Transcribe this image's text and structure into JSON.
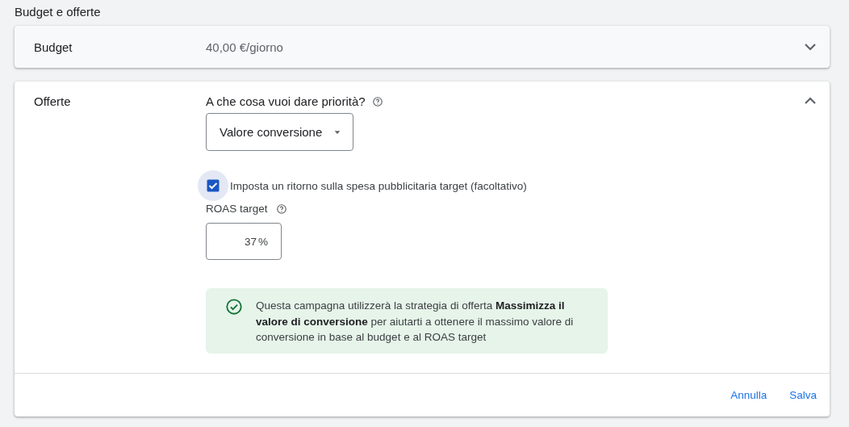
{
  "section_title": "Budget e offerte",
  "panels": [
    {
      "kind": "summary",
      "label": "Budget",
      "value": "40,00 €/giorno",
      "expanded": false
    },
    {
      "kind": "bidding",
      "label": "Offerte",
      "expanded": true,
      "question": "A che cosa vuoi dare priorità?",
      "dropdown": {
        "value": "Valore conversione"
      },
      "checkbox": {
        "label": "Imposta un ritorno sulla spesa pubblicitaria target (facoltativo)",
        "checked": true
      },
      "roas": {
        "label": "ROAS target",
        "value": "37",
        "unit": "%"
      },
      "info": "Questa campagna utilizzerà la strategia di offerta **Massimizza il valore di conversione** per aiutarti a ottenere il massimo valore di conversione in base al budget e al ROAS target",
      "buttons": [
        "Annulla",
        "Salva"
      ]
    }
  ]
}
